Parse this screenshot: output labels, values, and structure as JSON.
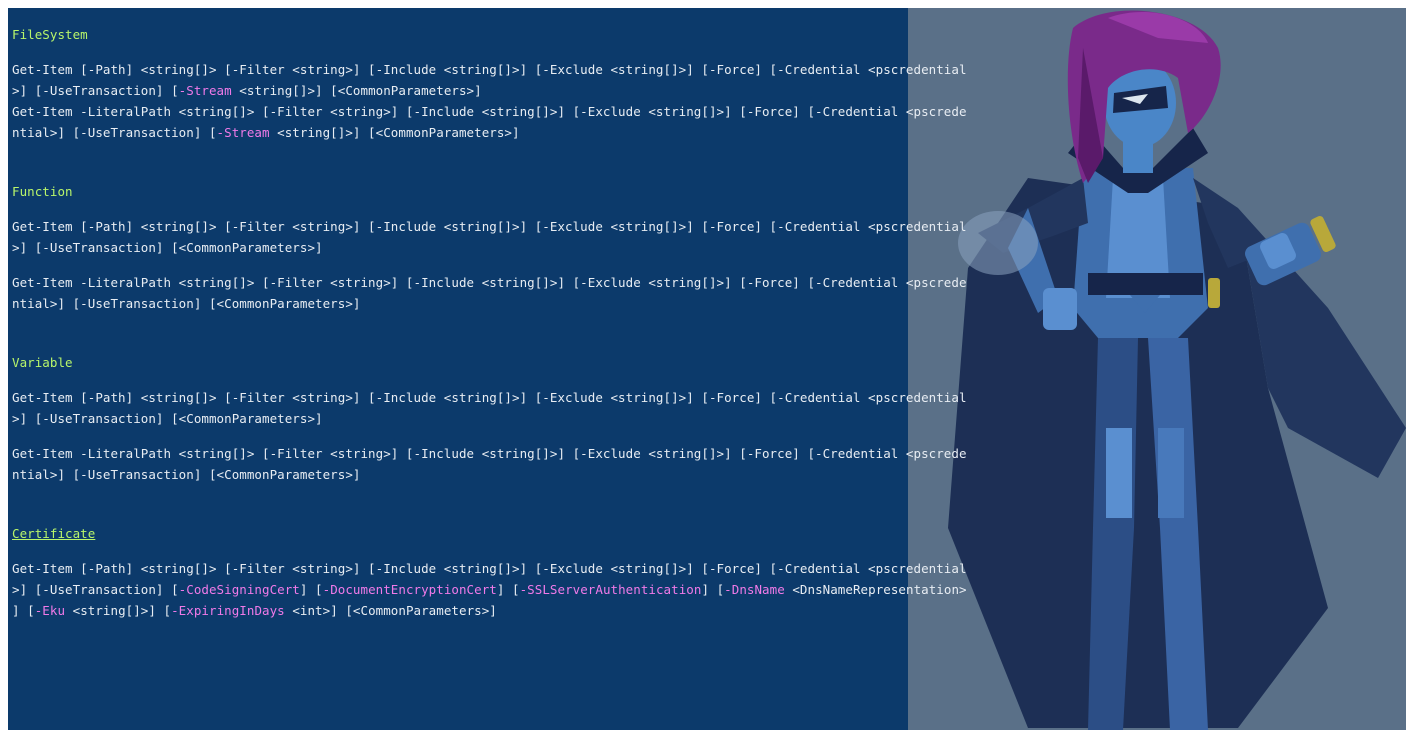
{
  "colors": {
    "console_bg": "#0c3a6b",
    "text": "#e8edf3",
    "header": "#b8f56a",
    "param_highlight": "#f07ae8",
    "backdrop": "#5a7088"
  },
  "sections": [
    {
      "header": "FileSystem",
      "blocks": [
        [
          "Get-Item [-Path] <string[]> [-Filter <string>] [-Include <string[]>] [-Exclude <string[]>] [-Force] [-Credential <pscredential",
          {
            "pre": ">] [-UseTransaction] [",
            "hl": "-Stream",
            "post": " <string[]>] [<CommonParameters>]"
          }
        ],
        [
          "Get-Item -LiteralPath <string[]> [-Filter <string>] [-Include <string[]>] [-Exclude <string[]>] [-Force] [-Credential <pscrede",
          {
            "pre": "ntial>] [-UseTransaction] [",
            "hl": "-Stream",
            "post": " <string[]>] [<CommonParameters>]"
          }
        ]
      ]
    },
    {
      "header": "Function",
      "blocks": [
        [
          "Get-Item [-Path] <string[]> [-Filter <string>] [-Include <string[]>] [-Exclude <string[]>] [-Force] [-Credential <pscredential",
          ">] [-UseTransaction] [<CommonParameters>]"
        ],
        [
          "Get-Item -LiteralPath <string[]> [-Filter <string>] [-Include <string[]>] [-Exclude <string[]>] [-Force] [-Credential <pscrede",
          "ntial>] [-UseTransaction] [<CommonParameters>]"
        ]
      ]
    },
    {
      "header": "Variable",
      "blocks": [
        [
          "Get-Item [-Path] <string[]> [-Filter <string>] [-Include <string[]>] [-Exclude <string[]>] [-Force] [-Credential <pscredential",
          ">] [-UseTransaction] [<CommonParameters>]"
        ],
        [
          "Get-Item -LiteralPath <string[]> [-Filter <string>] [-Include <string[]>] [-Exclude <string[]>] [-Force] [-Credential <pscrede",
          "ntial>] [-UseTransaction] [<CommonParameters>]"
        ]
      ]
    },
    {
      "header": "Certificate",
      "blocks": [
        [
          "Get-Item [-Path] <string[]> [-Filter <string>] [-Include <string[]>] [-Exclude <string[]>] [-Force] [-Credential <pscredential",
          {
            "segments": [
              {
                "t": ">] [-UseTransaction] ["
              },
              {
                "t": "-CodeSigningCert",
                "hl": true
              },
              {
                "t": "] ["
              },
              {
                "t": "-DocumentEncryptionCert",
                "hl": true
              },
              {
                "t": "] ["
              },
              {
                "t": "-SSLServerAuthentication",
                "hl": true
              },
              {
                "t": "] ["
              },
              {
                "t": "-DnsName",
                "hl": true
              },
              {
                "t": " <DnsNameRepresentation>"
              }
            ]
          },
          {
            "segments": [
              {
                "t": "] ["
              },
              {
                "t": "-Eku",
                "hl": true
              },
              {
                "t": " <string[]>] ["
              },
              {
                "t": "-ExpiringInDays",
                "hl": true
              },
              {
                "t": " <int>] [<CommonParameters>]"
              }
            ]
          }
        ]
      ]
    }
  ],
  "background_art": "armored-hero-illustration"
}
